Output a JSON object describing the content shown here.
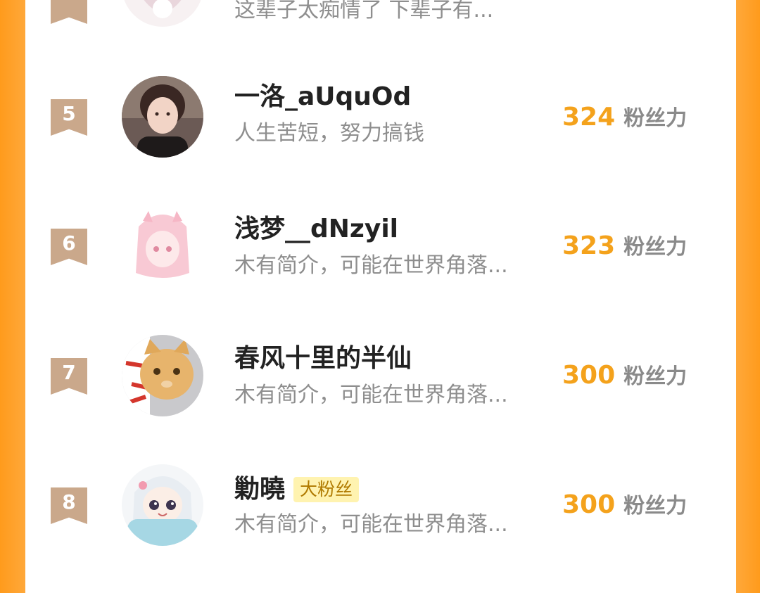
{
  "ranking": {
    "fans_label": "粉丝力",
    "rows": [
      {
        "rank": "",
        "name": "",
        "badge": "",
        "bio": "这辈子太痴情了 下辈子有...",
        "fans": "",
        "avatar": "anime-avatar-pink-white"
      },
      {
        "rank": "5",
        "name": "一洛_aUquOd",
        "badge": "",
        "bio": "人生苦短，努力搞钱",
        "fans": "324",
        "avatar": "photo-avatar-girl"
      },
      {
        "rank": "6",
        "name": "浅梦__dNzyil",
        "badge": "",
        "bio": "木有简介，可能在世界角落...",
        "fans": "323",
        "avatar": "anime-avatar-pink-hair"
      },
      {
        "rank": "7",
        "name": "春风十里的半仙",
        "badge": "",
        "bio": "木有简介，可能在世界角落...",
        "fans": "300",
        "avatar": "cat-avatar"
      },
      {
        "rank": "8",
        "name": "勦曉",
        "badge": "大粉丝",
        "bio": "木有简介，可能在世界角落...",
        "fans": "300",
        "avatar": "anime-avatar-white-hair"
      }
    ]
  },
  "colors": {
    "accent_orange": "#f4a21c",
    "rank_badge": "#caa88b",
    "border_orange": "#ff9b1c",
    "fan_badge_bg": "#fff3b0"
  }
}
